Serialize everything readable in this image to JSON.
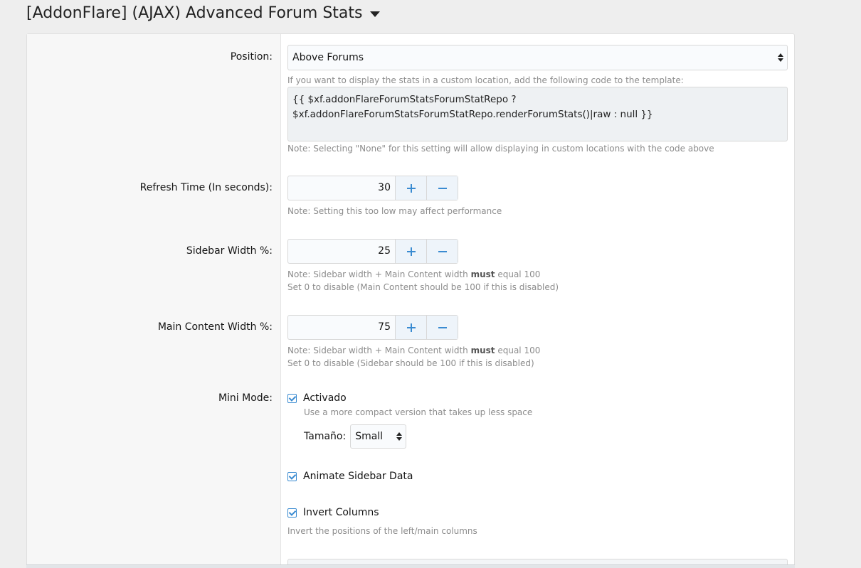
{
  "header": {
    "title": "[AddonFlare] (AJAX) Advanced Forum Stats"
  },
  "position": {
    "label": "Position:",
    "value": "Above Forums",
    "hint": "If you want to display the stats in a custom location, add the following code to the template:",
    "code_line1": "{{ $xf.addonFlareForumStatsForumStatRepo ?",
    "code_line2": "$xf.addonFlareForumStatsForumStatRepo.renderForumStats()|raw : null }}",
    "note": "Note: Selecting \"None\" for this setting will allow displaying in custom locations with the code above"
  },
  "refresh": {
    "label": "Refresh Time (In seconds):",
    "value": "30",
    "note": "Note: Setting this too low may affect performance"
  },
  "sidebar_width": {
    "label": "Sidebar Width %:",
    "value": "25",
    "note_prefix": "Note: Sidebar width + Main Content width ",
    "note_bold": "must",
    "note_suffix": " equal 100",
    "note2": "Set 0 to disable (Main Content should be 100 if this is disabled)"
  },
  "main_width": {
    "label": "Main Content Width %:",
    "value": "75",
    "note_prefix": "Note: Sidebar width + Main Content width ",
    "note_bold": "must",
    "note_suffix": " equal 100",
    "note2": "Set 0 to disable (Sidebar should be 100 if this is disabled)"
  },
  "mini_mode": {
    "label": "Mini Mode:",
    "checkbox_label": "Activado",
    "hint": "Use a more compact version that takes up less space",
    "size_label": "Tamaño:",
    "size_value": "Small"
  },
  "animate": {
    "checkbox_label": "Animate Sidebar Data"
  },
  "invert": {
    "checkbox_label": "Invert Columns",
    "hint": "Invert the positions of the left/main columns"
  },
  "colors": {
    "accent": "#3a8bd1",
    "label_bg": "#f7f7f7",
    "page_bg": "#eeeeee"
  }
}
